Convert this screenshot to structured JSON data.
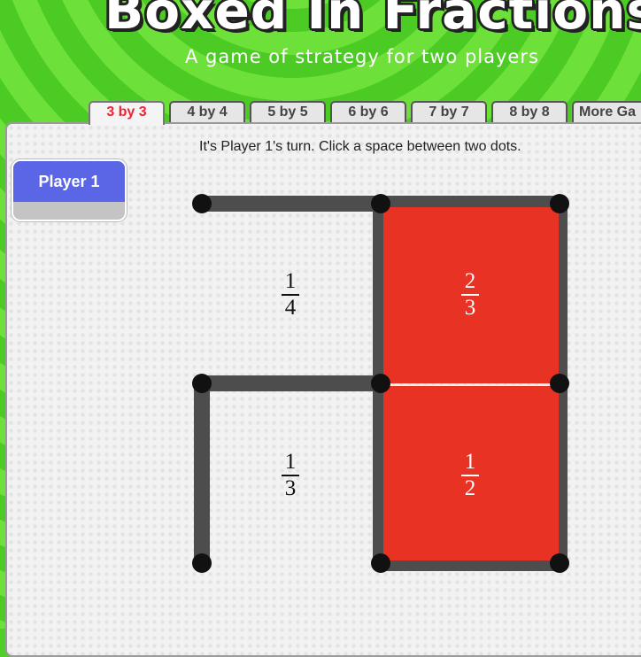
{
  "header": {
    "title": "Boxed In Fractions",
    "subtitle": "A game of strategy for two players"
  },
  "tabs": [
    {
      "label": "3 by 3",
      "active": true
    },
    {
      "label": "4 by 4",
      "active": false
    },
    {
      "label": "5 by 5",
      "active": false
    },
    {
      "label": "6 by 6",
      "active": false
    },
    {
      "label": "7 by 7",
      "active": false
    },
    {
      "label": "8 by 8",
      "active": false
    },
    {
      "label": "More Ga",
      "active": false
    }
  ],
  "status": "It's Player 1's turn. Click a space between two dots.",
  "player": {
    "name": "Player 1",
    "color": "#5b66e6"
  },
  "board": {
    "line_color": "#4d4d4d",
    "claimed_color": "#e83224",
    "cells": [
      {
        "fraction": {
          "num": "1",
          "den": "4"
        },
        "claimed": false
      },
      {
        "fraction": {
          "num": "2",
          "den": "3"
        },
        "claimed": true
      },
      {
        "fraction": {
          "num": "1",
          "den": "3"
        },
        "claimed": false
      },
      {
        "fraction": {
          "num": "1",
          "den": "2"
        },
        "claimed": true
      }
    ]
  }
}
